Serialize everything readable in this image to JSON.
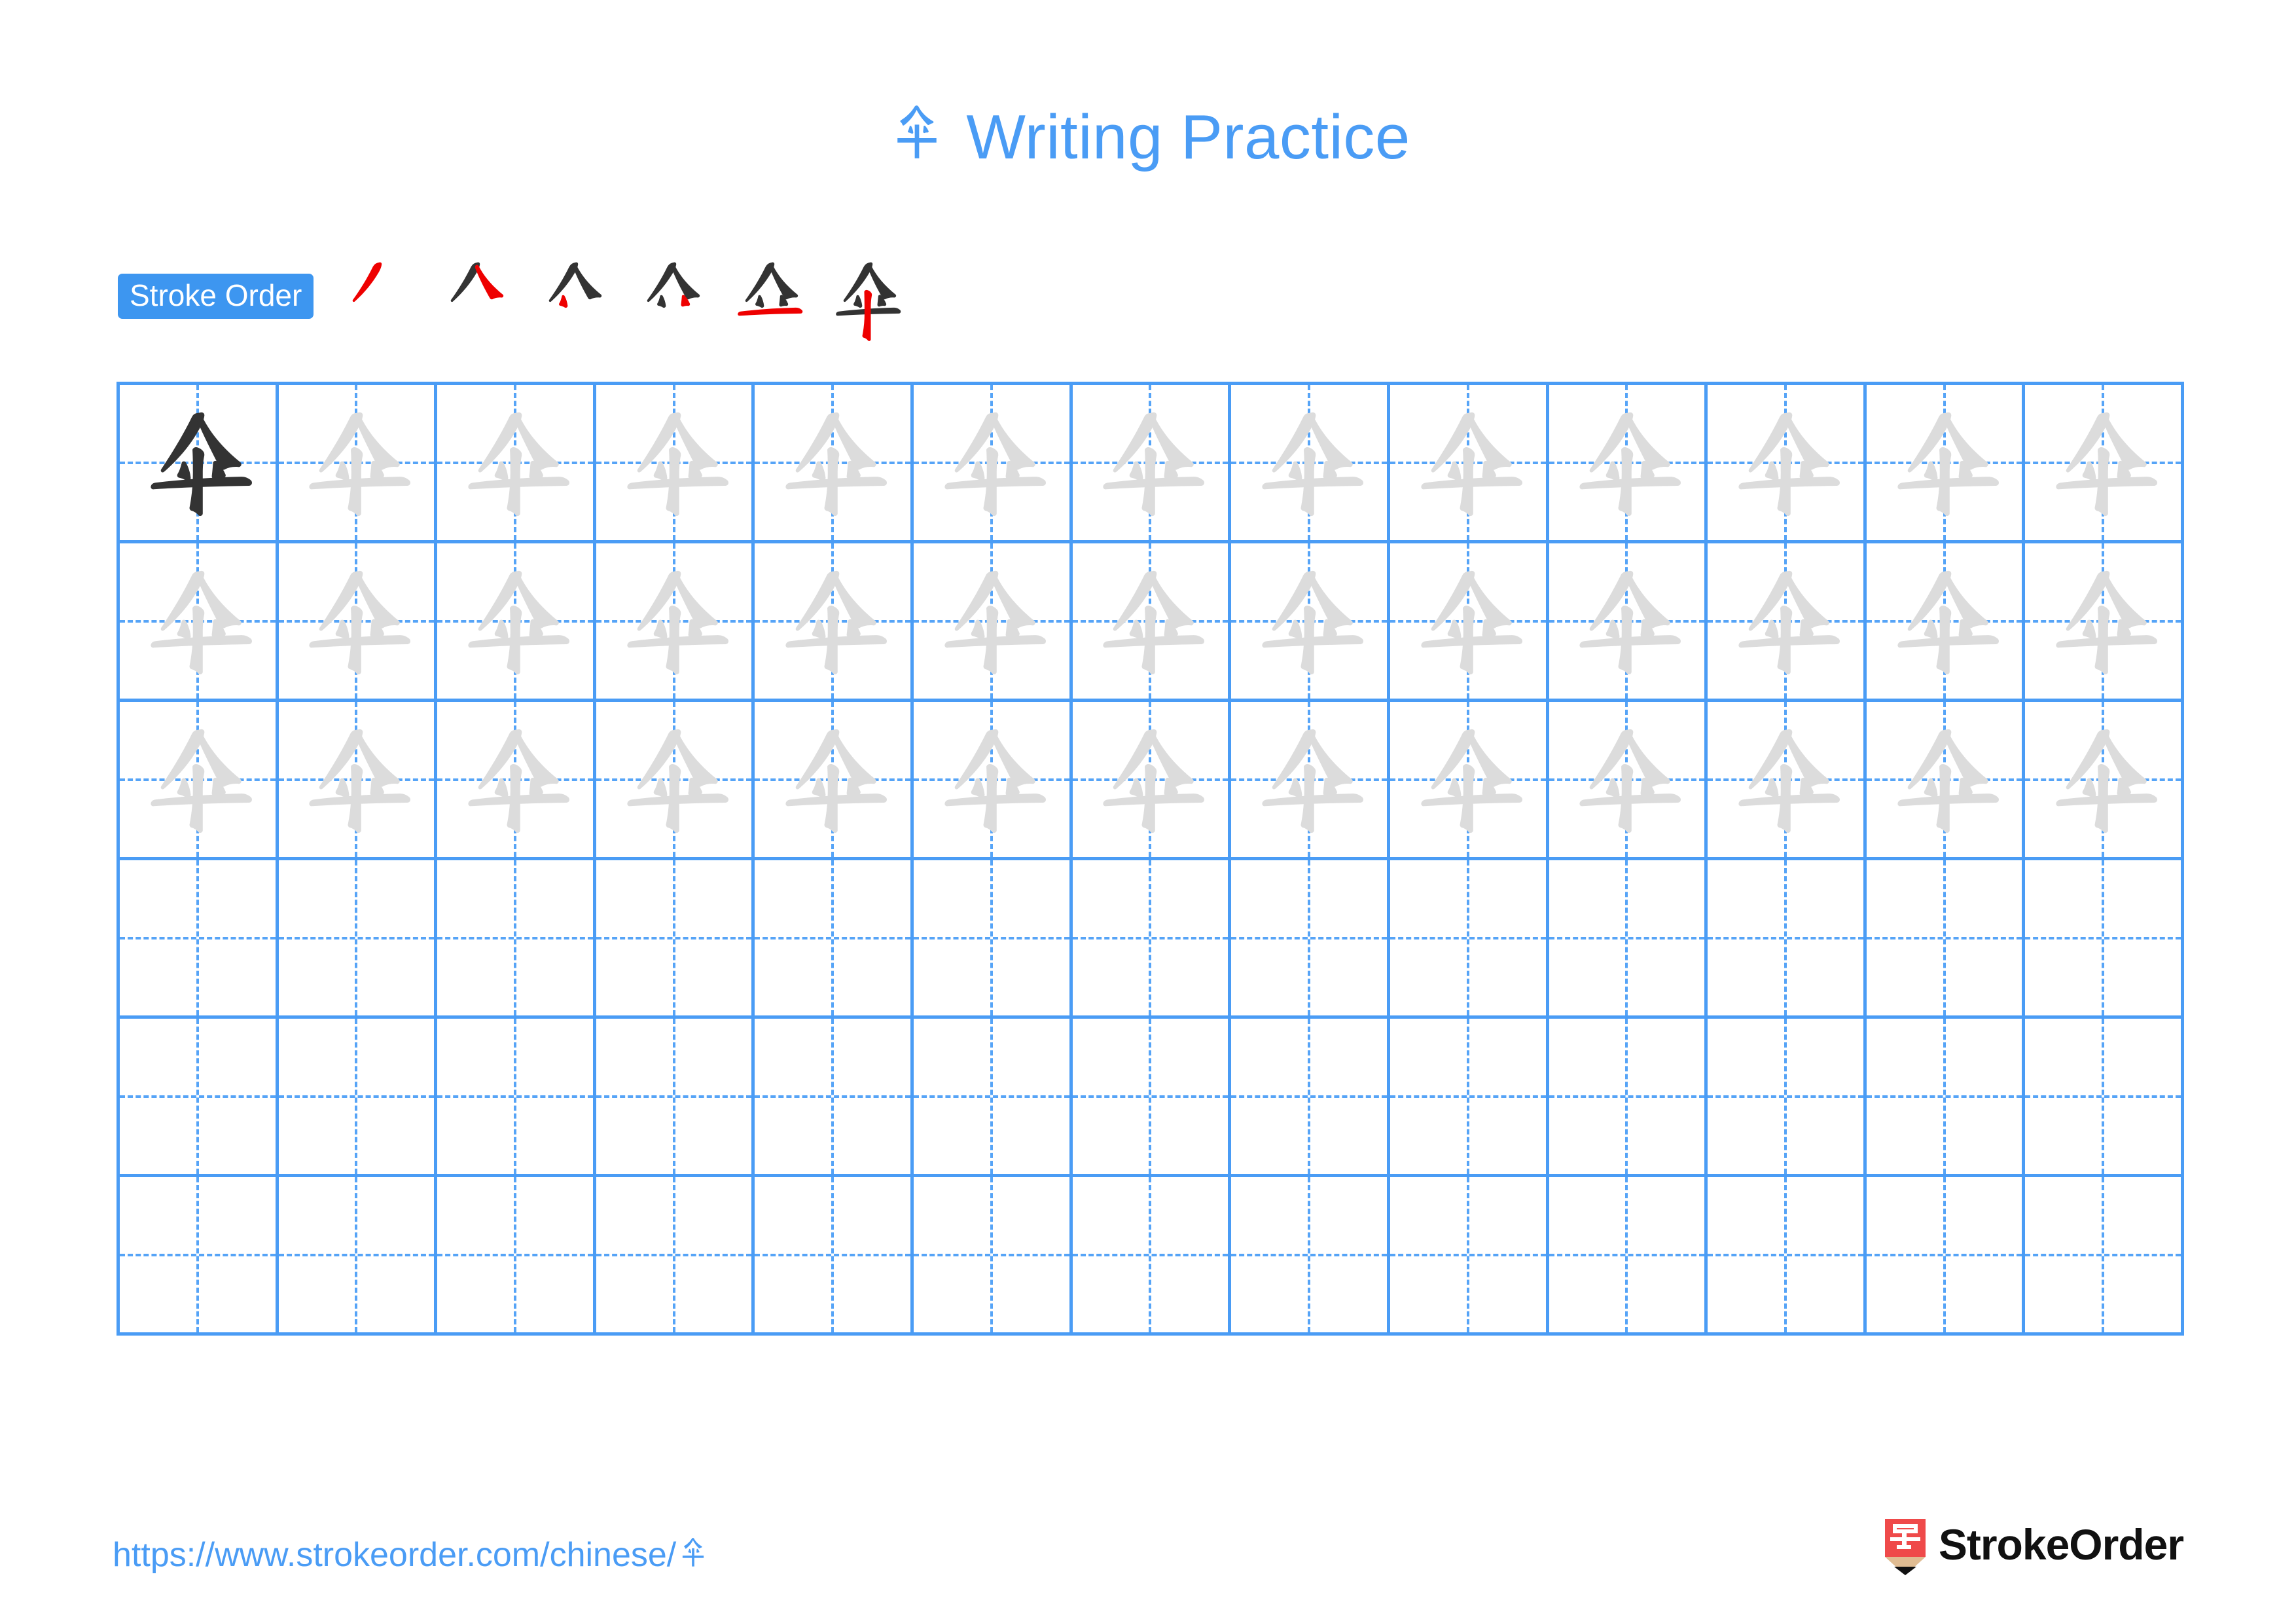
{
  "document": {
    "character": "伞",
    "title_suffix": " Writing Practice",
    "full_title": "伞 Writing Practice",
    "title_color": "#4a9cf5",
    "background_color": "#ffffff"
  },
  "stroke_order": {
    "badge_label": "Stroke Order",
    "badge_bg_color": "#3d96f0",
    "badge_text_color": "#ffffff",
    "new_stroke_color": "#ee0000",
    "prior_stroke_color": "#333333",
    "total_strokes": 6,
    "steps": [
      {
        "index": 1,
        "strokes_shown": 1,
        "new_stroke": "丿"
      },
      {
        "index": 2,
        "strokes_shown": 2,
        "new_stroke": "㇏"
      },
      {
        "index": 3,
        "strokes_shown": 3,
        "new_stroke": "丶"
      },
      {
        "index": 4,
        "strokes_shown": 4,
        "new_stroke": "丶"
      },
      {
        "index": 5,
        "strokes_shown": 5,
        "new_stroke": "一"
      },
      {
        "index": 6,
        "strokes_shown": 6,
        "new_stroke": "丨"
      }
    ]
  },
  "practice_grid": {
    "columns": 13,
    "rows": 6,
    "grid_line_color": "#4a9cf5",
    "guide_line_color": "#56a4f7",
    "traced_char_color": "#dcdcdc",
    "model_char_color": "#333333",
    "cells": [
      [
        "dark",
        "light",
        "light",
        "light",
        "light",
        "light",
        "light",
        "light",
        "light",
        "light",
        "light",
        "light",
        "light"
      ],
      [
        "light",
        "light",
        "light",
        "light",
        "light",
        "light",
        "light",
        "light",
        "light",
        "light",
        "light",
        "light",
        "light"
      ],
      [
        "light",
        "light",
        "light",
        "light",
        "light",
        "light",
        "light",
        "light",
        "light",
        "light",
        "light",
        "light",
        "light"
      ],
      [
        "empty",
        "empty",
        "empty",
        "empty",
        "empty",
        "empty",
        "empty",
        "empty",
        "empty",
        "empty",
        "empty",
        "empty",
        "empty"
      ],
      [
        "empty",
        "empty",
        "empty",
        "empty",
        "empty",
        "empty",
        "empty",
        "empty",
        "empty",
        "empty",
        "empty",
        "empty",
        "empty"
      ],
      [
        "empty",
        "empty",
        "empty",
        "empty",
        "empty",
        "empty",
        "empty",
        "empty",
        "empty",
        "empty",
        "empty",
        "empty",
        "empty"
      ]
    ]
  },
  "footer": {
    "url_prefix": "https://www.strokeorder.com/chinese/",
    "url_char": "伞",
    "url_full": "https://www.strokeorder.com/chinese/伞",
    "url_color": "#4a9cf5",
    "brand_name": "StrokeOrder",
    "brand_mark_char": "字",
    "brand_mark_bg_color": "#ef4a4a",
    "brand_mark_tip_color": "#e0bc92",
    "brand_text_color": "#111111"
  }
}
